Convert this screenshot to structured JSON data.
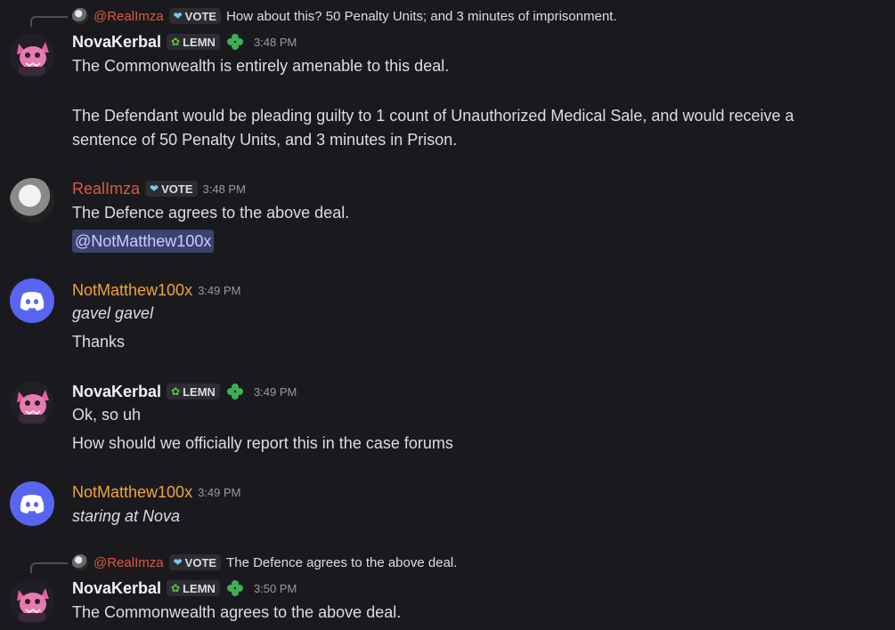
{
  "messages": [
    {
      "reply": {
        "name": "@RealImza",
        "tag": "VOTE",
        "text": "How about this? 50 Penalty Units; and 3 minutes of imprisonment."
      },
      "author": "NovaKerbal",
      "tag": "LEMN",
      "time": "3:48 PM",
      "lines": [
        "The Commonwealth is entirely amenable to this deal.",
        "The Defendant would be pleading guilty to 1 count of Unauthorized Medical Sale, and would receive a",
        "sentence of 50 Penalty Units, and 3 minutes in Prison."
      ]
    },
    {
      "author": "RealImza",
      "tag": "VOTE",
      "time": "3:48 PM",
      "lines": [
        "The Defence agrees to the above deal."
      ],
      "mention": "@NotMatthew100x"
    },
    {
      "author": "NotMatthew100x",
      "time": "3:49 PM",
      "lines": [
        "gavel gavel",
        "Thanks"
      ]
    },
    {
      "author": "NovaKerbal",
      "tag": "LEMN",
      "time": "3:49 PM",
      "lines": [
        "Ok, so uh",
        "How should we officially report this in the case forums"
      ]
    },
    {
      "author": "NotMatthew100x",
      "time": "3:49 PM",
      "lines": [
        "staring at Nova"
      ]
    },
    {
      "reply": {
        "name": "@RealImza",
        "tag": "VOTE",
        "text": "The Defence agrees to the above deal."
      },
      "author": "NovaKerbal",
      "tag": "LEMN",
      "time": "3:50 PM",
      "lines": [
        "The Commonwealth agrees to the above deal."
      ]
    }
  ],
  "colors": {
    "background": "#1a1a1e",
    "imza_name": "#e0563d",
    "matthew_name": "#f0a33b",
    "mention_bg": "#3c4270",
    "lemn_green": "#63c23b",
    "vote_blue": "#7cc7f0"
  },
  "icons": {
    "lemn_tag": "leaf-icon",
    "vote_tag": "heart-icon",
    "role": "clover-icon",
    "discord_avatar": "discord-logo-icon"
  }
}
